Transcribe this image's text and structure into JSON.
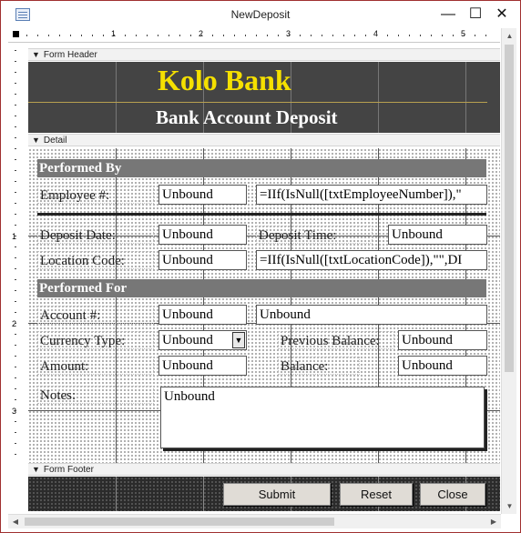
{
  "window": {
    "title": "NewDeposit",
    "minimize_glyph": "—",
    "maximize_glyph": "☐",
    "close_glyph": "✕"
  },
  "ruler": {
    "numbers": [
      "1",
      "2",
      "3",
      "4",
      "5"
    ],
    "vnumbers": [
      "1",
      "2",
      "3"
    ]
  },
  "sections": {
    "form_header": "Form Header",
    "detail": "Detail",
    "form_footer": "Form Footer"
  },
  "header": {
    "brand": "Kolo Bank",
    "subtitle": "Bank Account Deposit"
  },
  "detail": {
    "performed_by": "Performed By",
    "employee_label": "Employee #:",
    "employee_value": "Unbound",
    "employee_expr": "=IIf(IsNull([txtEmployeeNumber]),\"",
    "deposit_date_label": "Deposit Date:",
    "deposit_date_value": "Unbound",
    "deposit_time_label": "Deposit Time:",
    "deposit_time_value": "Unbound",
    "location_label": "Location Code:",
    "location_value": "Unbound",
    "location_expr": "=IIf(IsNull([txtLocationCode]),\"\",DI",
    "performed_for": "Performed For",
    "account_label": "Account #:",
    "account_value": "Unbound",
    "account_name_value": "Unbound",
    "currency_label": "Currency Type:",
    "currency_value": "Unbound",
    "prev_balance_label": "Previous Balance:",
    "prev_balance_value": "Unbound",
    "amount_label": "Amount:",
    "amount_value": "Unbound",
    "balance_label": "Balance:",
    "balance_value": "Unbound",
    "notes_label": "Notes:",
    "notes_value": "Unbound"
  },
  "footer": {
    "submit": "Submit",
    "reset": "Reset",
    "close": "Close"
  },
  "colors": {
    "brand_yellow": "#f5e000",
    "header_bg": "#444444",
    "band_gray": "#777777"
  }
}
